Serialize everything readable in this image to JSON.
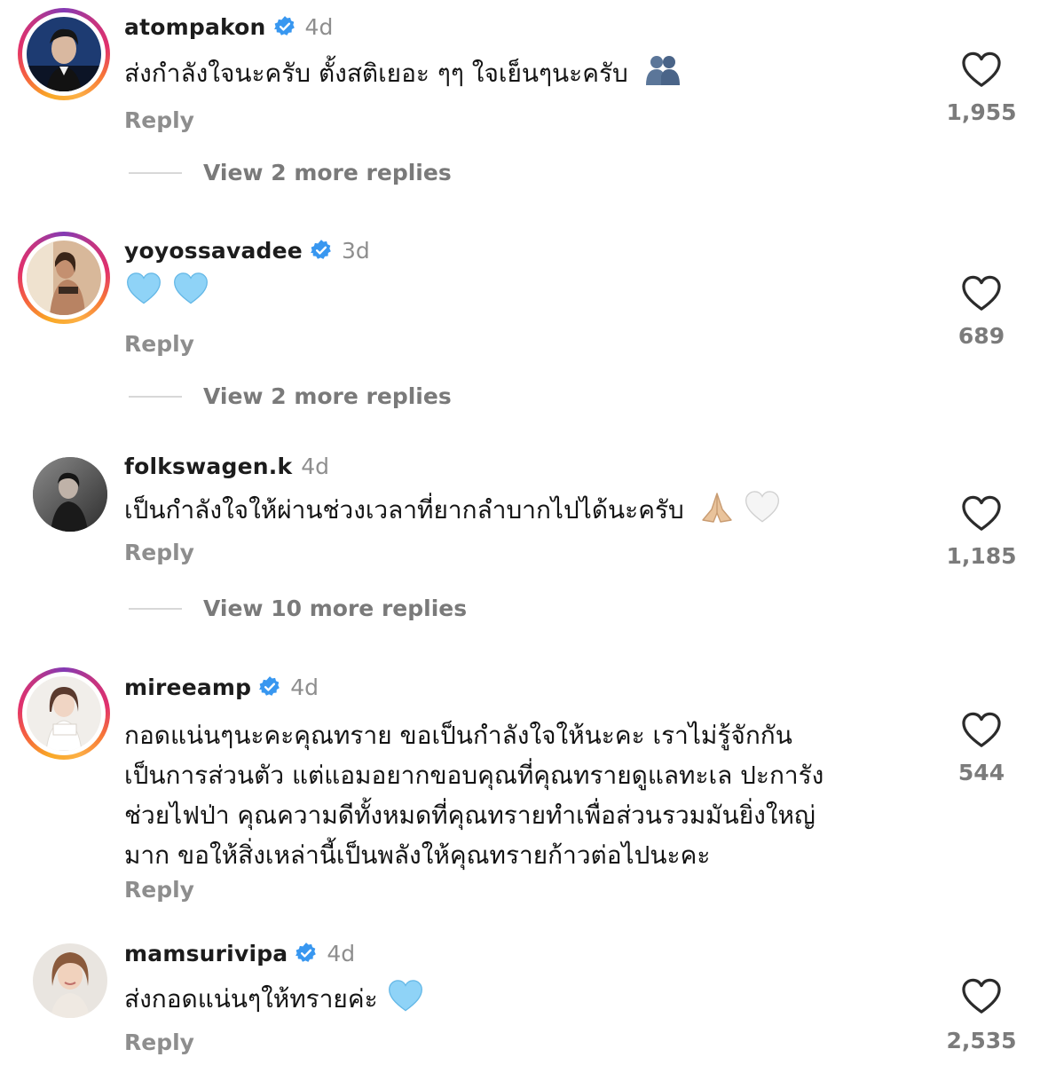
{
  "comments": [
    {
      "username": "atompakon",
      "verified": true,
      "time": "4d",
      "text": "ส่งกำลังใจนะครับ ตั้งสติเยอะ ๆๆ ใจเย็นๆนะครับ",
      "emoji": "hug-icon",
      "reply_label": "Reply",
      "more_replies": "View 2 more replies",
      "likes": "1,955",
      "story_ring": true
    },
    {
      "username": "yoyossavadee",
      "verified": true,
      "time": "3d",
      "text": "",
      "emoji": "two-light-blue-hearts",
      "reply_label": "Reply",
      "more_replies": "View 2 more replies",
      "likes": "689",
      "story_ring": true
    },
    {
      "username": "folkswagen.k",
      "verified": false,
      "time": "4d",
      "text": "เป็นกำลังใจให้ผ่านช่วงเวลาที่ยากลำบากไปได้นะครับ",
      "emoji": "folded-hands-and-white-heart",
      "reply_label": "Reply",
      "more_replies": "View 10 more replies",
      "likes": "1,185",
      "story_ring": false
    },
    {
      "username": "mireeamp",
      "verified": true,
      "time": "4d",
      "text_lines": [
        "กอดแน่นๆนะคะคุณทราย ขอเป็นกำลังใจให้นะคะ เราไม่รู้จักกัน",
        "เป็นการส่วนตัว แต่แอมอยากขอบคุณที่คุณทรายดูแลทะเล ปะการัง",
        "ช่วยไฟป่า คุณความดีทั้งหมดที่คุณทรายทำเพื่อส่วนรวมมันยิ่งใหญ่",
        "มาก ขอให้สิ่งเหล่านี้เป็นพลังให้คุณทรายก้าวต่อไปนะคะ"
      ],
      "reply_label": "Reply",
      "likes": "544",
      "story_ring": true
    },
    {
      "username": "mamsurivipa",
      "verified": true,
      "time": "4d",
      "text": "ส่งกอดแน่นๆให้ทรายค่ะ",
      "emoji": "light-blue-heart",
      "reply_label": "Reply",
      "likes": "2,535",
      "story_ring": false
    }
  ],
  "colors": {
    "verified_blue": "#3897f0",
    "light_blue_heart": "#7ec8f5",
    "muted_text": "#8e8e8e"
  }
}
